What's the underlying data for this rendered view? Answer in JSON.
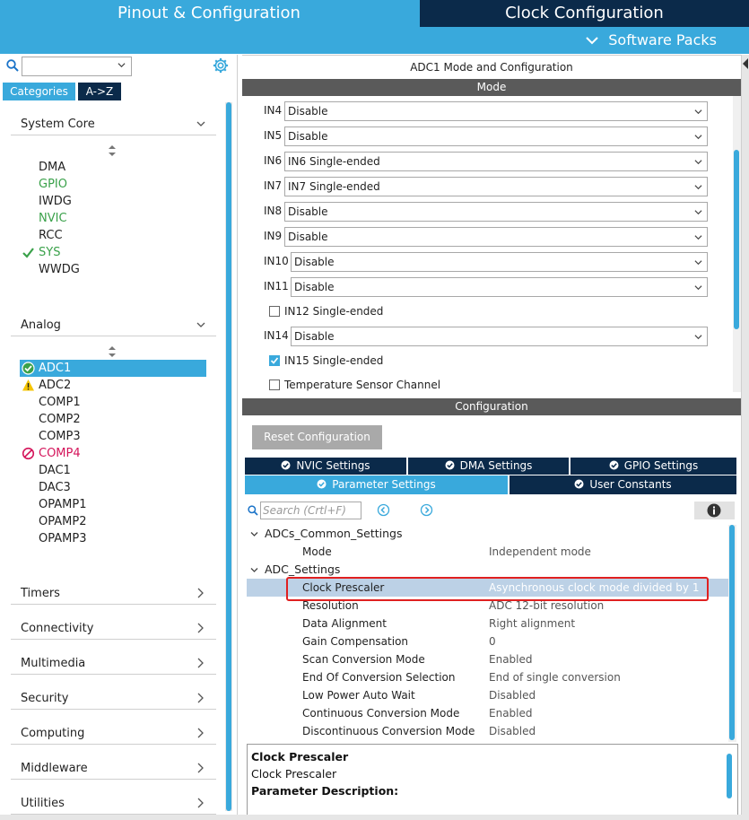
{
  "header": {
    "tab_pinout": "Pinout & Configuration",
    "tab_clock": "Clock Configuration",
    "software_packs": "Software Packs"
  },
  "sidebar": {
    "search_value": "",
    "tab_categories": "Categories",
    "tab_az": "A->Z",
    "system_core": {
      "label": "System Core",
      "items": [
        "DMA",
        "GPIO",
        "IWDG",
        "NVIC",
        "RCC",
        "SYS",
        "WWDG"
      ]
    },
    "analog": {
      "label": "Analog",
      "items": [
        "ADC1",
        "ADC2",
        "COMP1",
        "COMP2",
        "COMP3",
        "COMP4",
        "DAC1",
        "DAC3",
        "OPAMP1",
        "OPAMP2",
        "OPAMP3"
      ]
    },
    "categories": [
      "Timers",
      "Connectivity",
      "Multimedia",
      "Security",
      "Computing",
      "Middleware",
      "Utilities"
    ]
  },
  "mode": {
    "title": "ADC1 Mode and Configuration",
    "bar": "Mode",
    "inputs": [
      {
        "label": "IN4",
        "value": "Disable"
      },
      {
        "label": "IN5",
        "value": "Disable"
      },
      {
        "label": "IN6",
        "value": "IN6 Single-ended"
      },
      {
        "label": "IN7",
        "value": "IN7 Single-ended"
      },
      {
        "label": "IN8",
        "value": "Disable"
      },
      {
        "label": "IN9",
        "value": "Disable"
      },
      {
        "label": "IN10",
        "value": "Disable"
      },
      {
        "label": "IN11",
        "value": "Disable"
      },
      {
        "label": "IN14",
        "value": "Disable"
      }
    ],
    "checks": [
      {
        "label": "IN12 Single-ended",
        "checked": false
      },
      {
        "label": "IN15 Single-ended",
        "checked": true
      },
      {
        "label": "Temperature Sensor Channel",
        "checked": false
      }
    ]
  },
  "configuration": {
    "bar": "Configuration",
    "reset_button": "Reset Configuration",
    "tabs": [
      "NVIC Settings",
      "DMA Settings",
      "GPIO Settings",
      "Parameter Settings",
      "User Constants"
    ],
    "search_placeholder": "Search (Crtl+F)",
    "groups": [
      {
        "label": "ADCs_Common_Settings",
        "params": [
          {
            "name": "Mode",
            "value": "Independent mode"
          }
        ]
      },
      {
        "label": "ADC_Settings",
        "params": [
          {
            "name": "Clock Prescaler",
            "value": "Asynchronous clock mode divided by 1"
          },
          {
            "name": "Resolution",
            "value": "ADC 12-bit resolution"
          },
          {
            "name": "Data Alignment",
            "value": "Right alignment"
          },
          {
            "name": "Gain Compensation",
            "value": "0"
          },
          {
            "name": "Scan Conversion Mode",
            "value": "Enabled"
          },
          {
            "name": "End Of Conversion Selection",
            "value": "End of single conversion"
          },
          {
            "name": "Low Power Auto Wait",
            "value": "Disabled"
          },
          {
            "name": "Continuous Conversion Mode",
            "value": "Enabled"
          },
          {
            "name": "Discontinuous Conversion Mode",
            "value": "Disabled"
          }
        ]
      }
    ],
    "description": {
      "title": "Clock Prescaler",
      "subtitle": "Clock Prescaler",
      "param_desc_label": "Parameter Description:"
    }
  },
  "colors": {
    "accent": "#39a9dc",
    "dark": "#0b2a4a",
    "ok_green": "#3aa14a",
    "warning": "#f5c400",
    "error": "#d4145a",
    "highlight": "#e02020"
  }
}
